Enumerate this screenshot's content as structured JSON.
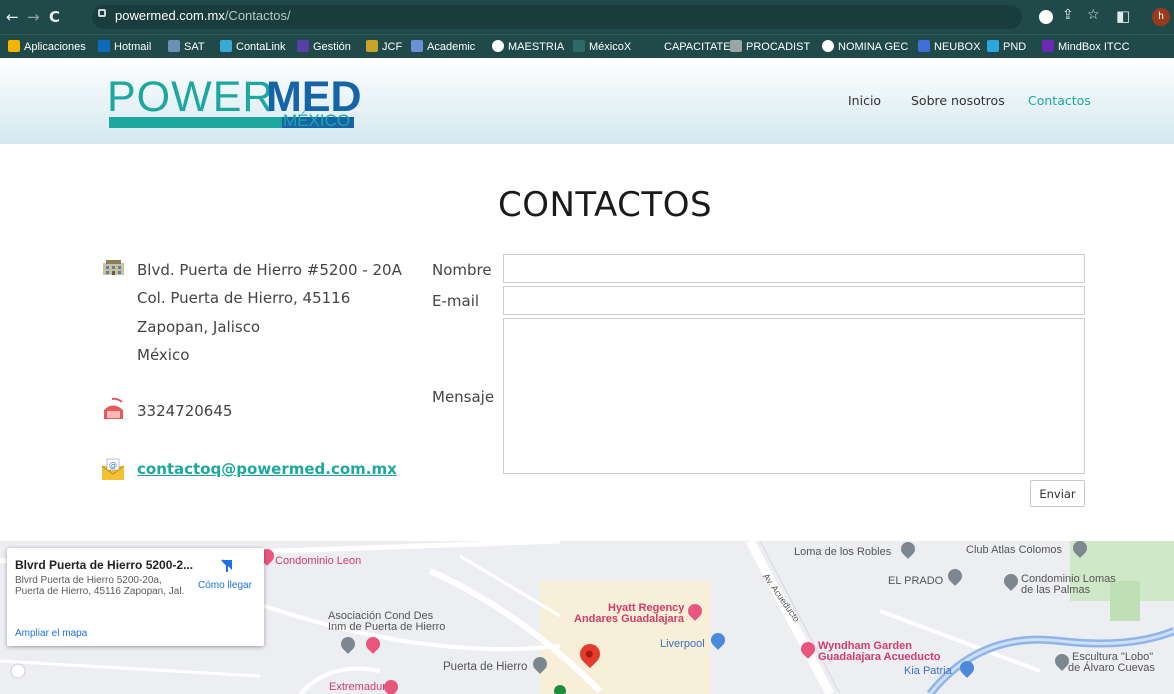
{
  "browser": {
    "url_host": "powermed.com.mx",
    "url_path": "/Contactos/",
    "avatar_letter": "h",
    "bookmarks": [
      {
        "label": "Aplicaciones",
        "color": "#f4b400"
      },
      {
        "label": "Hotmail",
        "color": "#0f6cbd"
      },
      {
        "label": "SAT",
        "color": "#6b8fb5"
      },
      {
        "label": "ContaLink",
        "color": "#3aa9d6"
      },
      {
        "label": "Gestión",
        "color": "#5b3fa8"
      },
      {
        "label": "JCF",
        "color": "#c9a227"
      },
      {
        "label": "Academic",
        "color": "#6c8fd8"
      },
      {
        "label": "MAESTRIA",
        "color": "#ffffff"
      },
      {
        "label": "MéxicoX",
        "color": "#2f6a69"
      },
      {
        "label": "CAPACITATE",
        "color": "#1f4a49"
      },
      {
        "label": "PROCADIST",
        "color": "#9aa5a5"
      },
      {
        "label": "NOMINA GEC",
        "color": "#ffffff"
      },
      {
        "label": "NEUBOX",
        "color": "#3e6fd6"
      },
      {
        "label": "PND",
        "color": "#2aa7e0"
      },
      {
        "label": "MindBox ITCC",
        "color": "#6a2ab3"
      }
    ]
  },
  "site": {
    "logo_power": "POWER",
    "logo_med": "MED",
    "logo_country": "MÉXICO",
    "nav": [
      "Inicio",
      "Sobre nosotros",
      "Contactos"
    ],
    "active_nav": "Contactos",
    "brand_color": "#1da7a1"
  },
  "page": {
    "title": "CONTACTOS",
    "address": [
      "Blvd. Puerta de Hierro #5200 - 20A",
      "Col. Puerta de Hierro, 45116",
      "Zapopan, Jalisco",
      "México"
    ],
    "phone": "3324720645",
    "email": "contactoq@powermed.com.mx"
  },
  "form": {
    "name_label": "Nombre",
    "email_label": "E-mail",
    "message_label": "Mensaje",
    "name_value": "",
    "email_value": "",
    "message_value": "",
    "submit_label": "Enviar"
  },
  "map": {
    "card_title": "Blvrd Puerta de Hierro 5200-2...",
    "card_address": "Blvrd Puerta de Hierro 5200-20a, Puerta de Hierro, 45116 Zapopan, Jal.",
    "directions_label": "Cómo llegar",
    "enlarge_label": "Ampliar el mapa",
    "places": {
      "condominio_leon": "Condominio Leon",
      "loma_robles": "Loma de los Robles",
      "club_atlas": "Club Atlas Colomos",
      "el_prado": "EL PRADO",
      "condominio_lomas_1": "Condominio Lomas",
      "condominio_lomas_2": "de las Palmas",
      "av_acueducto": "Av. Acueducto",
      "hyatt_1": "Hyatt Regency",
      "hyatt_2": "Andares Guadalajara",
      "asociacion_1": "Asociación Cond Des",
      "asociacion_2": "Inm de Puerta de Hierro",
      "liverpool": "Liverpool",
      "wyndham_1": "Wyndham Garden",
      "wyndham_2": "Guadalajara Acueducto",
      "escultura_1": "Escultura \"Lobo\"",
      "escultura_2": "de Álvaro Cuevas",
      "kia": "Kia Patria",
      "puerta_hierro": "Puerta de Hierro",
      "extremadura": "Extremadura"
    }
  }
}
